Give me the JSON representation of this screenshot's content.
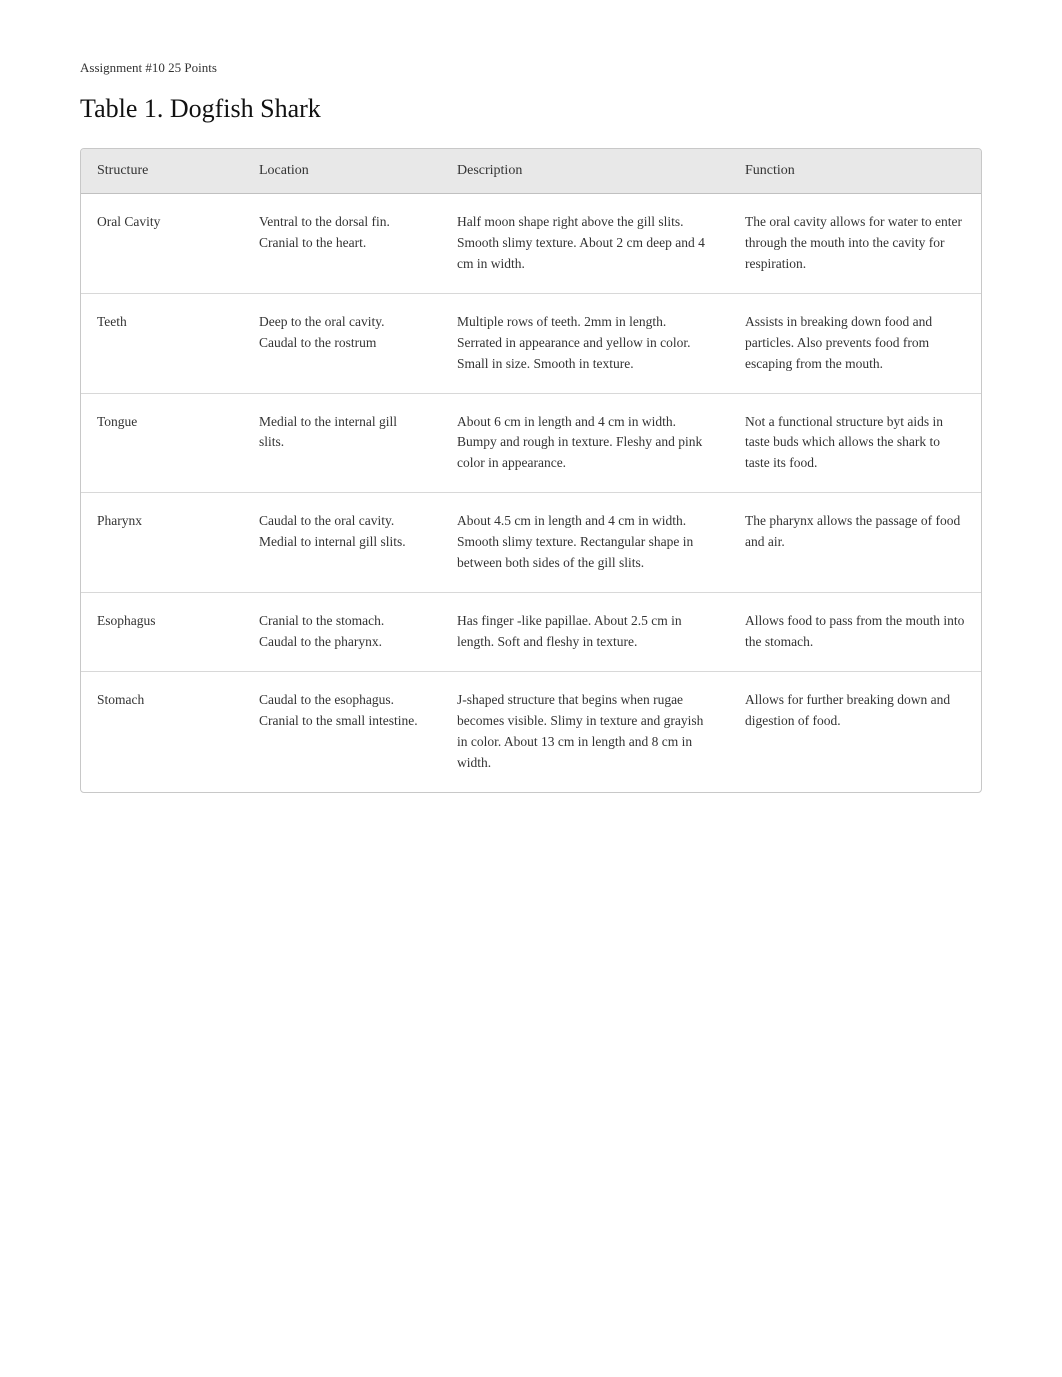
{
  "assignment": {
    "line": "Assignment #10  25 Points"
  },
  "title": "Table 1. Dogfish Shark",
  "table": {
    "headers": [
      "Structure",
      "Location",
      "Description",
      "Function"
    ],
    "rows": [
      {
        "structure": "Oral Cavity",
        "location": "Ventral to the dorsal fin. Cranial to the heart.",
        "description": "Half  moon shape right above the gill slits. Smooth slimy texture. About 2 cm deep and 4 cm in width.",
        "function": "The oral cavity allows for water to enter through the mouth into the cavity for respiration."
      },
      {
        "structure": "Teeth",
        "location": "Deep to the oral cavity. Caudal to the rostrum",
        "description": "Multiple rows of teeth. 2mm in length. Serrated in appearance and yellow in color. Small in size. Smooth in texture.",
        "function": "Assists in breaking down food and particles. Also prevents food from escaping from the mouth."
      },
      {
        "structure": "Tongue",
        "location": "Medial to the internal gill slits.",
        "description": "About 6 cm in length and 4 cm in width. Bumpy and rough in texture. Fleshy and pink color in appearance.",
        "function": "Not a functional structure byt aids in taste buds which allows the shark to taste its food."
      },
      {
        "structure": "Pharynx",
        "location": "Caudal to the oral cavity. Medial to internal gill slits.",
        "description": "About 4.5 cm in length and 4 cm in width. Smooth slimy texture. Rectangular shape in between both sides of the gill slits.",
        "function": "The pharynx allows the passage of food and air."
      },
      {
        "structure": "Esophagus",
        "location": "Cranial to the stomach. Caudal to the pharynx.",
        "description": "Has  finger -like papillae. About 2.5 cm in length. Soft and fleshy in texture.",
        "function": "Allows food to pass from the mouth into the stomach."
      },
      {
        "structure": "Stomach",
        "location": "Caudal to the esophagus. Cranial to the small intestine.",
        "description": "J-shaped structure that begins when rugae becomes visible. Slimy in texture and grayish in color. About 13 cm in length and 8 cm in width.",
        "function": "Allows for further breaking down and digestion of food."
      }
    ]
  }
}
